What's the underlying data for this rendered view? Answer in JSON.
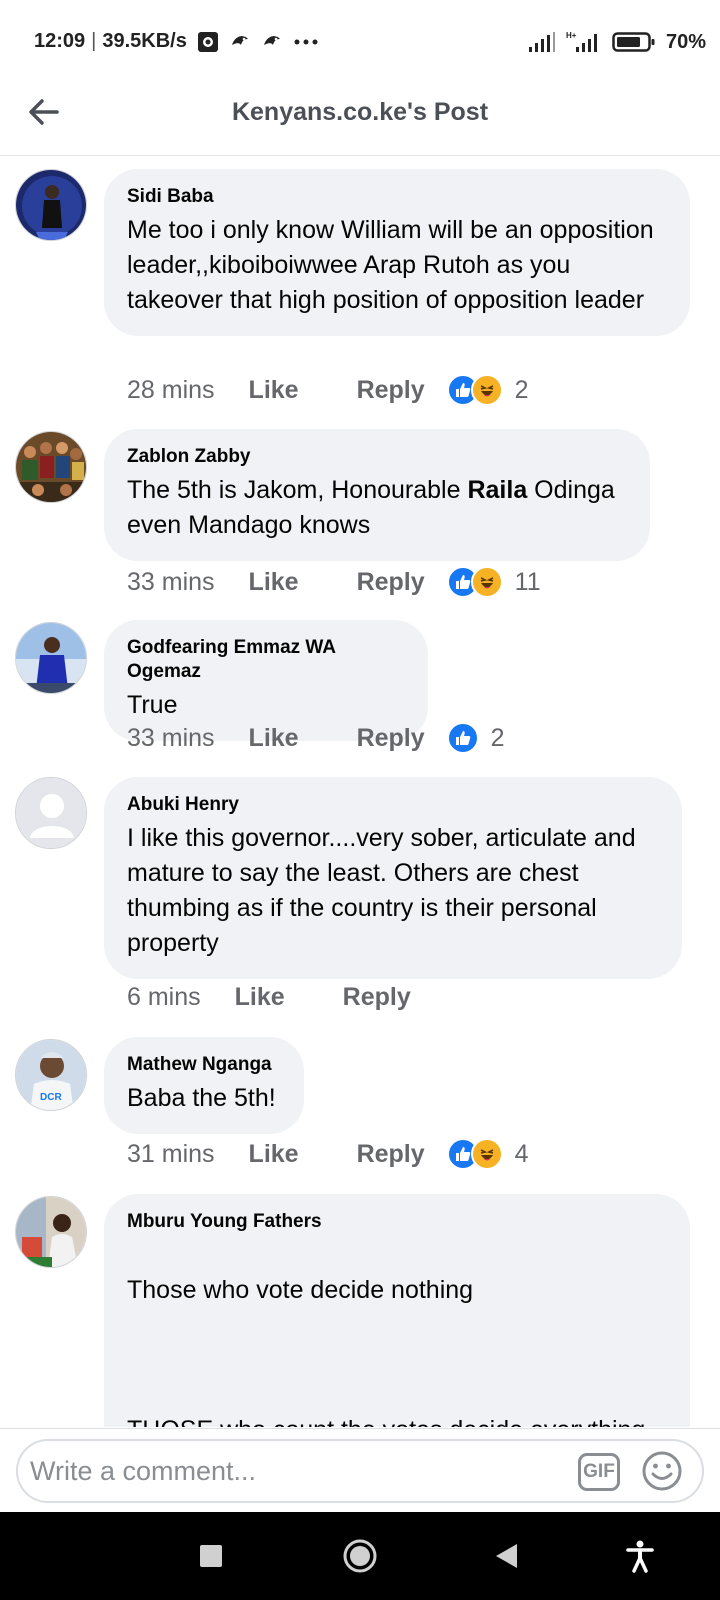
{
  "status_bar": {
    "time": "12:09",
    "separator": "|",
    "speed": "39.5KB/s",
    "battery_percent": "70%"
  },
  "header": {
    "title": "Kenyans.co.ke's Post"
  },
  "comments": [
    {
      "author": "Sidi Baba",
      "text": "Me too i only know William will be an opposition leader,,kiboiboiwwee Arap Rutoh as you takeover that high position of opposition leader",
      "time": "28 mins",
      "like_label": "Like",
      "reply_label": "Reply",
      "reactions": [
        "like",
        "haha"
      ],
      "reaction_count": "2"
    },
    {
      "author": "Zablon Zabby",
      "text_before": "The 5th is Jakom, Honourable ",
      "text_bold": "Raila",
      "text_after": " Odinga even Mandago knows",
      "time": "33 mins",
      "like_label": "Like",
      "reply_label": "Reply",
      "reactions": [
        "like",
        "haha"
      ],
      "reaction_count": "11"
    },
    {
      "author": "Godfearing Emmaz WA Ogemaz",
      "text": "True",
      "time": "33 mins",
      "like_label": "Like",
      "reply_label": "Reply",
      "reactions": [
        "like"
      ],
      "reaction_count": "2"
    },
    {
      "author": "Abuki Henry",
      "text": "I like this governor....very sober, articulate and mature to say the least. Others are chest thumbing as if the country is their personal property",
      "time": "6 mins",
      "like_label": "Like",
      "reply_label": "Reply",
      "reactions": [],
      "reaction_count": ""
    },
    {
      "author": "Mathew Nganga",
      "text": "Baba the 5th!",
      "time": "31 mins",
      "like_label": "Like",
      "reply_label": "Reply",
      "reactions": [
        "like",
        "haha"
      ],
      "reaction_count": "4"
    },
    {
      "author": "Mburu Young Fathers",
      "text_line1": "Those who vote decide nothing",
      "text_line2": "THOSE who count the votes decide everything.",
      "text_more": "...",
      "time": "",
      "like_label": "",
      "reply_label": ""
    }
  ],
  "composer": {
    "placeholder": "Write a comment...",
    "gif_label": "GIF"
  },
  "colors": {
    "bubble": "#f0f2f5",
    "like_blue": "#1877f2",
    "haha_yellow": "#f7b125",
    "meta_gray": "#65676b"
  },
  "icons": {
    "back": "arrow-left-icon",
    "emoji": "smiley-icon",
    "nav_recents": "square-icon",
    "nav_home": "circle-icon",
    "nav_back": "triangle-back-icon",
    "nav_accessibility": "accessibility-icon"
  }
}
